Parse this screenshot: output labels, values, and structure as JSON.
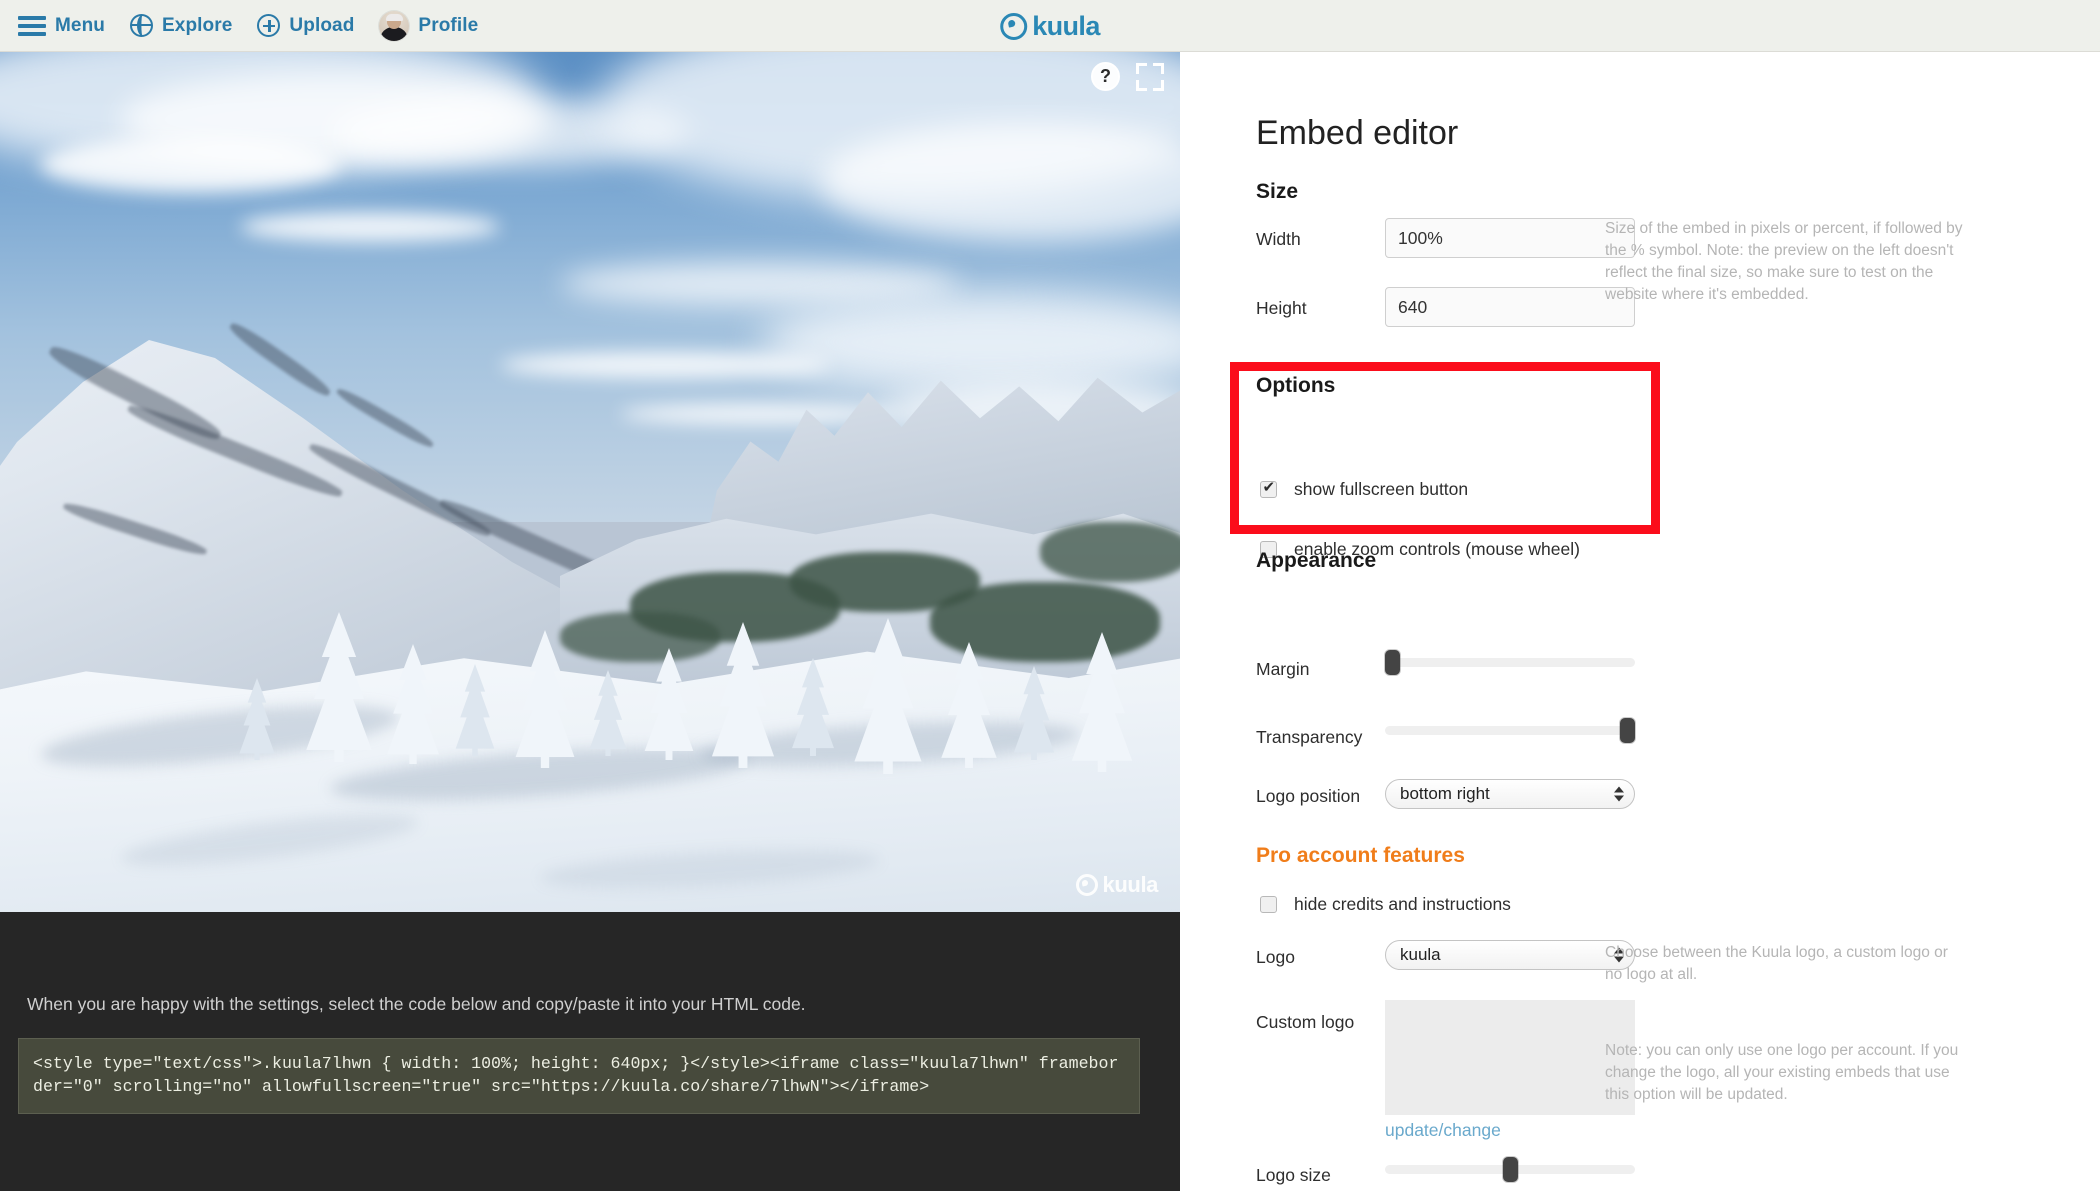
{
  "nav": {
    "items": [
      {
        "label": "Menu",
        "icon": "hamburger-icon"
      },
      {
        "label": "Explore",
        "icon": "globe-icon"
      },
      {
        "label": "Upload",
        "icon": "plus-circle-icon"
      },
      {
        "label": "Profile",
        "icon": "avatar-icon"
      }
    ],
    "brand": "kuula",
    "brand_color": "#2a88b5",
    "bg_color": "#eef0eb",
    "link_color": "#2a7aa8"
  },
  "preview": {
    "help_button": "?",
    "fullscreen_button": "fullscreen-icon",
    "watermark": "kuula",
    "scene": "snow-covered mountain panorama with blue sky, clouds and frosted evergreen trees"
  },
  "code_panel": {
    "intro": "When you are happy with the settings, select the code below and copy/paste it into your HTML code.",
    "snippet": "<style type=\"text/css\">.kuula7lhwn { width: 100%; height: 640px; }</style><iframe class=\"kuula7lhwn\" frameborder=\"0\" scrolling=\"no\" allowfullscreen=\"true\" src=\"https://kuula.co/share/7lhwN\"></iframe>",
    "bg_color": "#262626",
    "code_bg_color": "#474a3c"
  },
  "editor": {
    "title": "Embed editor",
    "size": {
      "heading": "Size",
      "width_label": "Width",
      "width_value": "100%",
      "height_label": "Height",
      "height_value": "640",
      "help": "Size of the embed in pixels or percent, if followed by the % symbol. Note: the preview on the left doesn't reflect the final size, so make sure to test on the website where it's embedded."
    },
    "options": {
      "heading": "Options",
      "highlighted": true,
      "highlight_color": "#fb0d1b",
      "items": [
        {
          "label": "show fullscreen button",
          "checked": true
        },
        {
          "label": "enable zoom controls (mouse wheel)",
          "checked": false
        }
      ]
    },
    "appearance": {
      "heading": "Appearance",
      "margin_label": "Margin",
      "margin_value": 0,
      "transparency_label": "Transparency",
      "transparency_value": 100,
      "logo_position_label": "Logo position",
      "logo_position_value": "bottom right"
    },
    "pro": {
      "heading": "Pro account features",
      "heading_color": "#f07d1a",
      "hide_credits_label": "hide credits and instructions",
      "hide_credits_checked": false,
      "logo_label": "Logo",
      "logo_value": "kuula",
      "logo_help": "Choose between the Kuula logo, a custom logo or no logo at all.",
      "custom_logo_label": "Custom logo",
      "custom_logo_link": "update/change",
      "custom_logo_help": "Note: you can only use one logo per account. If you change the logo, all your existing embeds that use this option will be updated.",
      "logo_size_label": "Logo size",
      "logo_size_value": 50
    }
  }
}
